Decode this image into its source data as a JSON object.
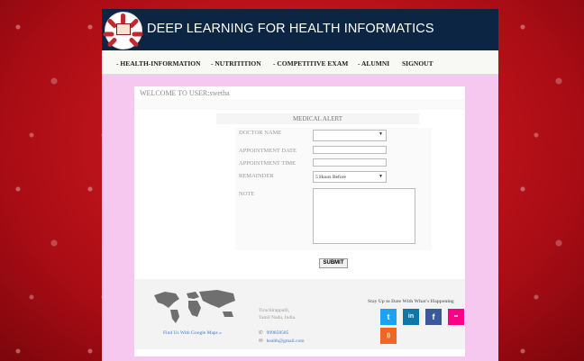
{
  "header": {
    "title": "DEEP LEARNING FOR HEALTH INFORMATICS"
  },
  "nav": {
    "items": [
      {
        "label": "- HEALTH-INFORMATION"
      },
      {
        "label": "- NUTRITITION"
      },
      {
        "label": "- COMPETITIVE EXAM"
      },
      {
        "label": "- ALUMNI"
      },
      {
        "label": "SIGNOUT"
      }
    ]
  },
  "welcome": "WELCOME TO USER:swetha",
  "form": {
    "heading": "MEDICAL ALERT",
    "doctor_label": "DOCTOR NAME",
    "doctor_value": "",
    "date_label": "APPOINTMENT DATE",
    "date_value": "",
    "time_label": "APPOINTMENT TIME",
    "time_value": "",
    "reminder_label": "REMAINDER",
    "reminder_value": "5 Hours Before",
    "note_label": "NOTE",
    "note_value": "",
    "submit_label": "SUBMIT"
  },
  "footer": {
    "maps_link": "Find Us With Google Maps »",
    "address_line1": "Tiruchirappalli,",
    "address_line2": "Tamil Nadu, India.",
    "phone": "999858585",
    "email": "health@gmail.com",
    "stay_text": "Stay Up to Date With What's Happening",
    "social": [
      {
        "icon": "twitter-icon",
        "glyph": "t",
        "color": "#1da1f2"
      },
      {
        "icon": "linkedin-icon",
        "glyph": "in",
        "color": "#0e76a8"
      },
      {
        "icon": "facebook-icon",
        "glyph": "f",
        "color": "#3b5998"
      },
      {
        "icon": "flickr-icon",
        "glyph": "••",
        "color": "#ff0084"
      },
      {
        "icon": "rss-icon",
        "glyph": "))",
        "color": "#f26522"
      }
    ]
  }
}
